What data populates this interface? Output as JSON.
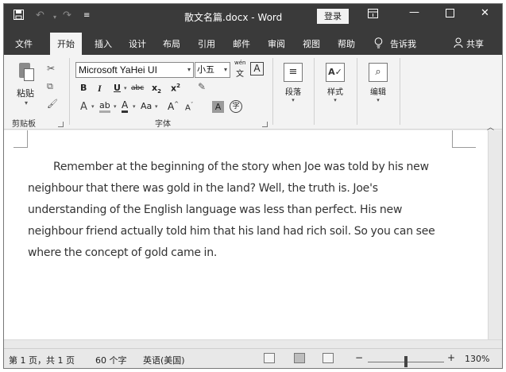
{
  "titlebar": {
    "save_icon": "save-icon",
    "undo_icon": "undo-icon",
    "redo_icon": "redo-icon",
    "customize_icon": "customize-quick-access-icon",
    "title": "散文名篇.docx  -  Word",
    "login_label": "登录",
    "ribbon_display_icon": "ribbon-display-options-icon",
    "minimize_icon": "minimize-icon",
    "maximize_icon": "maximize-icon",
    "close_icon": "close-icon"
  },
  "tabs": {
    "items": [
      "文件",
      "开始",
      "插入",
      "设计",
      "布局",
      "引用",
      "邮件",
      "审阅",
      "视图",
      "帮助"
    ],
    "active": "开始",
    "tell_me": "告诉我",
    "share": "共享"
  },
  "ribbon": {
    "clipboard": {
      "paste_label": "粘贴",
      "group_label": "剪贴板"
    },
    "font": {
      "font_name": "Microsoft YaHei UI",
      "font_size": "小五",
      "phonetic_label": "wén",
      "phonetic_char": "文",
      "char_border": "A",
      "bold": "B",
      "italic": "I",
      "underline": "U",
      "strikethrough": "abc",
      "subscript": "x",
      "superscript": "x",
      "effects": "A",
      "highlight": "ab",
      "font_color": "A",
      "change_case": "Aa",
      "grow": "A",
      "shrink": "A",
      "char_shading": "A",
      "enclose": "字",
      "group_label": "字体"
    },
    "paragraph_label": "段落",
    "styles_label": "样式",
    "editing_label": "编辑"
  },
  "document": {
    "paragraph": "Remember at the beginning of the story when Joe was told by his new neighbour that there was gold in the land? Well, the truth is. Joe's understanding of the English language was less than perfect. His new neighbour friend actually told him that his land had rich soil. So you can see where the concept of gold came in."
  },
  "statusbar": {
    "page_info": "第 1 页，共 1 页",
    "word_count": "60 个字",
    "language": "英语(美国)",
    "zoom_minus": "−",
    "zoom_plus": "+",
    "zoom": "130%",
    "zoom_fraction": 0.5
  },
  "colors": {
    "titlebar_bg": "#3a3a3a",
    "ribbon_bg": "#f3f3f3",
    "statusbar_bg": "#e8e8e8"
  }
}
